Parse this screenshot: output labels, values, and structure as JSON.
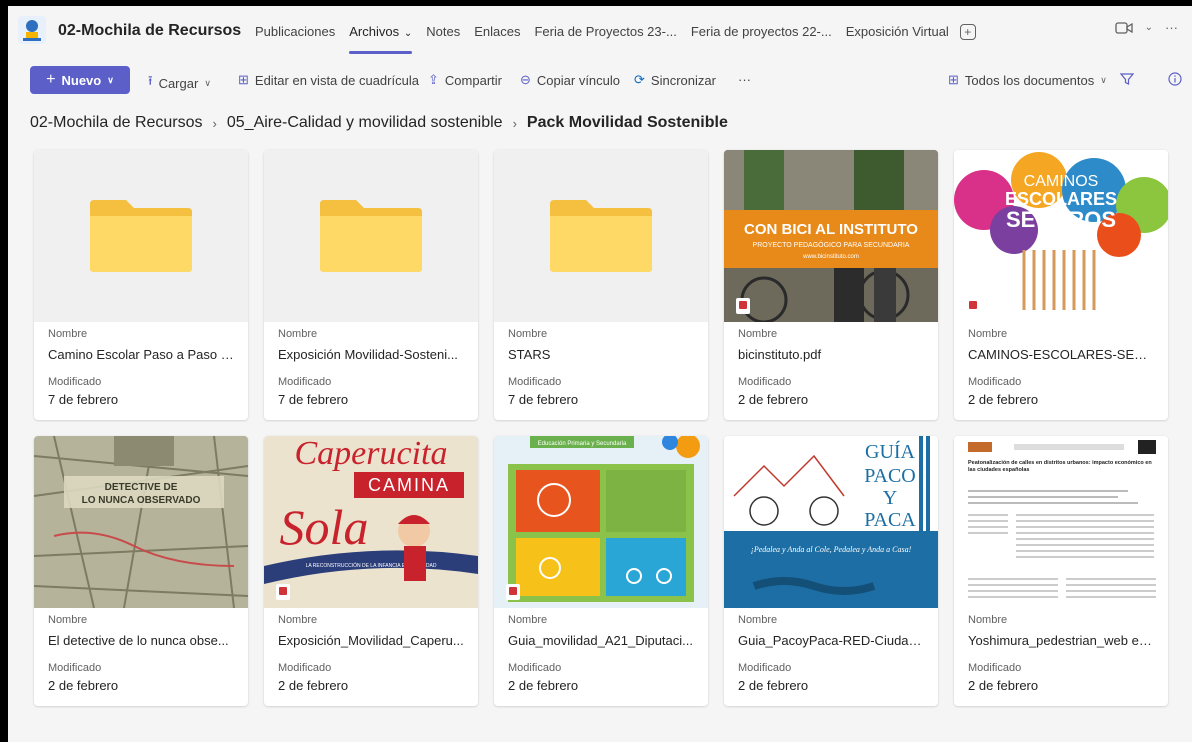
{
  "team": {
    "name": "02-Mochila de Recursos"
  },
  "tabs": [
    {
      "label": "Publicaciones"
    },
    {
      "label": "Archivos"
    },
    {
      "label": "Notes"
    },
    {
      "label": "Enlaces"
    },
    {
      "label": "Feria de Proyectos 23-..."
    },
    {
      "label": "Feria de proyectos 22-..."
    },
    {
      "label": "Exposición Virtual"
    }
  ],
  "active_tab": "Archivos",
  "toolbar": {
    "new_label": "Nuevo",
    "upload_label": "Cargar",
    "grid_edit_label": "Editar en vista de cuadrícula",
    "share_label": "Compartir",
    "copy_link_label": "Copiar vínculo",
    "sync_label": "Sincronizar",
    "more_label": "···",
    "view_label": "Todos los documentos"
  },
  "breadcrumb": [
    "02-Mochila de Recursos",
    "05_Aire-Calidad y movilidad sostenible",
    "Pack Movilidad Sostenible"
  ],
  "labels": {
    "name": "Nombre",
    "modified": "Modificado"
  },
  "files": [
    {
      "name": "Camino Escolar Paso a Paso D...",
      "modified": "7 de febrero",
      "type": "folder"
    },
    {
      "name": "Exposición Movilidad-Sosteni...",
      "modified": "7 de febrero",
      "type": "folder"
    },
    {
      "name": "STARS",
      "modified": "7 de febrero",
      "type": "folder"
    },
    {
      "name": "bicinstituto.pdf",
      "modified": "2 de febrero",
      "type": "pdf",
      "thumb_title": "CON BICI AL INSTITUTO",
      "thumb_sub": "PROYECTO PEDAGÓGICO PARA SECUNDARIA",
      "thumb_url": "www.bicinstituto.com"
    },
    {
      "name": "CAMINOS-ESCOLARES-SEGU...",
      "modified": "2 de febrero",
      "type": "pdf",
      "thumb_l1": "CAMINOS",
      "thumb_l2": "ESCOLARES",
      "thumb_l3": "SEGUROS"
    },
    {
      "name": "El detective de lo nunca obse...",
      "modified": "2 de febrero",
      "type": "pdf",
      "thumb_l1": "DETECTIVE DE",
      "thumb_l2": "LO NUNCA OBSERVADO"
    },
    {
      "name": "Exposición_Movilidad_Caperu...",
      "modified": "2 de febrero",
      "type": "pdf",
      "thumb_l1": "Caperucita",
      "thumb_l2": "CAMINA",
      "thumb_l3": "Sola",
      "thumb_l4": "LA RECONSTRUCCIÓN DE LA INFANCIA EN LA CIUDAD"
    },
    {
      "name": "Guia_movilidad_A21_Diputaci...",
      "modified": "2 de febrero",
      "type": "pdf",
      "thumb_l1": "Educación Primaria y Secundaria"
    },
    {
      "name": "Guia_PacoyPaca-RED-Ciudad...",
      "modified": "2 de febrero",
      "type": "pdf",
      "thumb_l1": "GUÍA",
      "thumb_l2": "PACO",
      "thumb_l3": "Y",
      "thumb_l4": "PACA",
      "thumb_l5": "¡Pedalea y Anda al Cole, Pedalea y Anda a Casa!"
    },
    {
      "name": "Yoshimura_pedestrian_web es...",
      "modified": "2 de febrero",
      "type": "pdf",
      "thumb_l1": "Peatonalización de calles en distritos urbanos: impacto económico en las ciudades españolas"
    }
  ]
}
